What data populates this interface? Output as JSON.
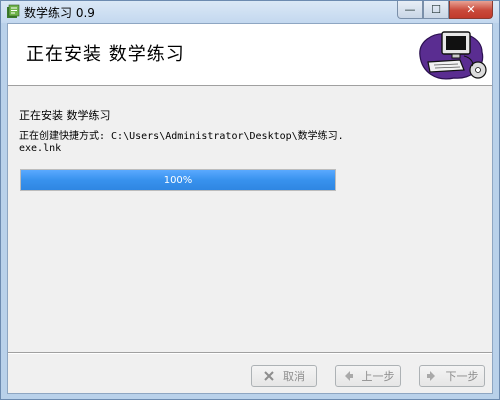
{
  "window": {
    "title": "数学练习 0.9",
    "min_glyph": "—",
    "max_glyph": "☐",
    "close_glyph": "✕"
  },
  "header": {
    "title": "正在安装 数学练习"
  },
  "body": {
    "status": "正在安装 数学练习",
    "detail": "正在创建快捷方式: C:\\Users\\Administrator\\Desktop\\数学练习.exe.lnk",
    "progress_label": "100%",
    "progress_fraction": 1.0
  },
  "buttons": {
    "cancel": "取消",
    "back": "上一步",
    "next": "下一步"
  },
  "colors": {
    "progress": "#3892ee",
    "accent": "#b9d1ea"
  }
}
